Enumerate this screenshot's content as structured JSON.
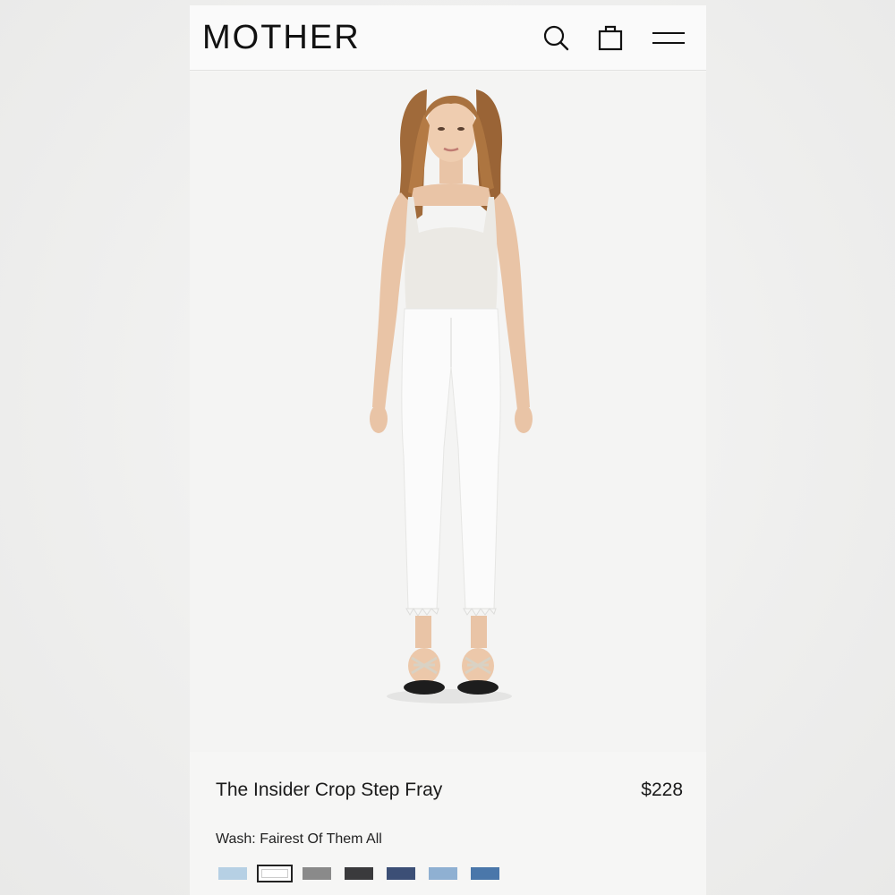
{
  "header": {
    "logo": "MOTHER",
    "icons": [
      "search-icon",
      "bag-icon",
      "menu-icon"
    ]
  },
  "product": {
    "title": "The Insider Crop Step Fray",
    "price": "$228",
    "wash_label": "Wash: Fairest Of Them All",
    "image_alt": "Model wearing white cropped flare jeans, white tank, sandals"
  },
  "swatches": [
    {
      "name": "light-blue",
      "color": "#b6d0e4",
      "selected": false
    },
    {
      "name": "white",
      "color": "#ffffff",
      "selected": true
    },
    {
      "name": "grey",
      "color": "#8a8a8a",
      "selected": false
    },
    {
      "name": "black",
      "color": "#3a3a3c",
      "selected": false
    },
    {
      "name": "dark-indigo",
      "color": "#3c4f76",
      "selected": false
    },
    {
      "name": "mid-blue",
      "color": "#8fb0d2",
      "selected": false
    },
    {
      "name": "medium-blue",
      "color": "#4a77aa",
      "selected": false
    }
  ]
}
